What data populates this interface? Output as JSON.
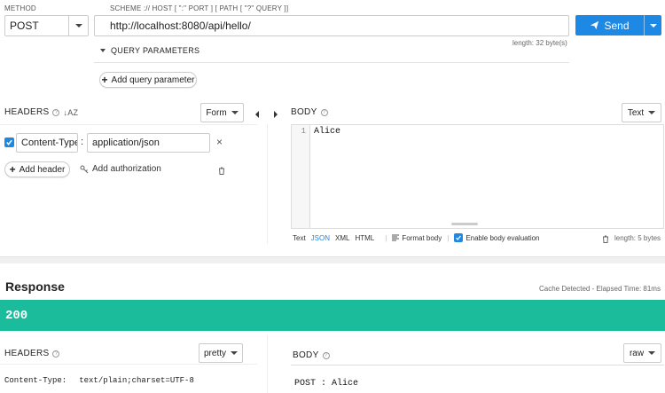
{
  "request": {
    "method_label": "METHOD",
    "method_value": "POST",
    "url_label": "SCHEME :// HOST [ \":\" PORT ] [ PATH [ \"?\" QUERY ]]",
    "url_value": "http://localhost:8080/api/hello/",
    "url_length": "length: 32 byte(s)",
    "send_label": "Send",
    "query_params_label": "QUERY PARAMETERS",
    "add_query_label": "Add query parameter",
    "headers_label": "HEADERS",
    "headers_sort_glyph": "↓AZ",
    "form_select": "Form",
    "header_row": {
      "name": "Content-Type",
      "separator": ":",
      "value": "application/json"
    },
    "add_header_label": "Add header",
    "add_auth_label": "Add authorization",
    "body_label": "BODY",
    "body_type_select": "Text",
    "body_line_number": "1",
    "body_content": "Alice",
    "body_formats": [
      "Text",
      "JSON",
      "XML",
      "HTML"
    ],
    "format_body_label": "Format body",
    "enable_eval_label": "Enable body evaluation",
    "body_length": "length: 5 bytes"
  },
  "response": {
    "title": "Response",
    "cache_info": "Cache Detected - Elapsed Time: 81ms",
    "status_code": "200",
    "headers_label": "HEADERS",
    "headers_view_select": "pretty",
    "header_line_key": "Content-Type:",
    "header_line_value": "text/plain;charset=UTF-8",
    "body_label": "BODY",
    "body_view_select": "raw",
    "body_content": "POST : Alice"
  },
  "colors": {
    "accent": "#1e88e5",
    "status_bar": "#1abc9c",
    "json_format": "#1e88e5"
  }
}
